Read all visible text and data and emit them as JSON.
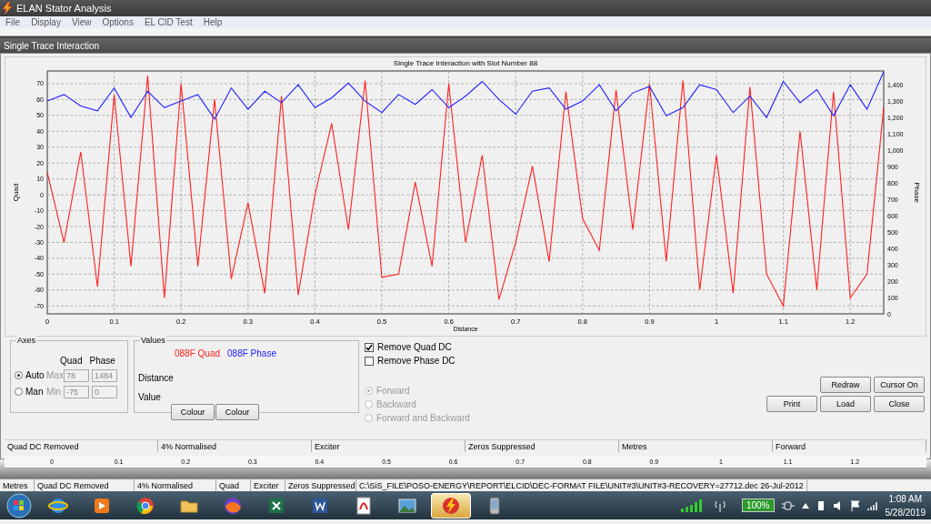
{
  "window": {
    "title": "ELAN Stator Analysis"
  },
  "menu": [
    "File",
    "Display",
    "View",
    "Options",
    "EL CID Test",
    "Help"
  ],
  "child_window": {
    "title": "Single Trace Interaction"
  },
  "chart": {
    "chart_data": {
      "type": "line",
      "grid": true,
      "title": "Single Trace Interaction with Slot Number 88",
      "xlabel": "Distance",
      "ylabel": "Quad",
      "y2label": "Phase",
      "xlim": [
        0,
        1.25
      ],
      "ylim": [
        -75,
        78
      ],
      "y2lim": [
        0,
        1484
      ],
      "xticks": [
        0,
        0.1,
        0.2,
        0.3,
        0.4,
        0.5,
        0.6,
        0.7,
        0.8,
        0.9,
        1,
        1.1,
        1.2
      ],
      "yticks": [
        -70,
        -60,
        -50,
        -40,
        -30,
        -20,
        -10,
        0,
        10,
        20,
        30,
        40,
        50,
        60,
        70
      ],
      "y2ticks": [
        {
          "value": 0,
          "label": "0"
        },
        {
          "value": 100,
          "label": "100"
        },
        {
          "value": 200,
          "label": "200"
        },
        {
          "value": 300,
          "label": "300"
        },
        {
          "value": 400,
          "label": "400"
        },
        {
          "value": 500,
          "label": "500"
        },
        {
          "value": 600,
          "label": "600"
        },
        {
          "value": 700,
          "label": "700"
        },
        {
          "value": 800,
          "label": "800"
        },
        {
          "value": 900,
          "label": "900"
        },
        {
          "value": 1000,
          "label": "1,000"
        },
        {
          "value": 1100,
          "label": "1,100"
        },
        {
          "value": 1200,
          "label": "1,200"
        },
        {
          "value": 1300,
          "label": "1,300"
        },
        {
          "value": 1400,
          "label": "1,400"
        }
      ],
      "x": [
        0,
        0.025,
        0.05,
        0.075,
        0.1,
        0.125,
        0.15,
        0.175,
        0.2,
        0.225,
        0.25,
        0.275,
        0.3,
        0.325,
        0.35,
        0.375,
        0.4,
        0.425,
        0.45,
        0.475,
        0.5,
        0.525,
        0.55,
        0.575,
        0.6,
        0.625,
        0.65,
        0.675,
        0.7,
        0.725,
        0.75,
        0.775,
        0.8,
        0.825,
        0.85,
        0.875,
        0.9,
        0.925,
        0.95,
        0.975,
        1,
        1.025,
        1.05,
        1.075,
        1.1,
        1.125,
        1.15,
        1.175,
        1.2,
        1.225,
        1.25
      ],
      "series": [
        {
          "name": "088F Quad",
          "color": "#ff2020",
          "values": [
            14,
            -30,
            27,
            -58,
            63,
            -45,
            75,
            -65,
            70,
            -45,
            60,
            -53,
            -5,
            -62,
            62,
            -63,
            0,
            45,
            -22,
            72,
            -52,
            -50,
            8,
            -45,
            70,
            -30,
            25,
            -66,
            -30,
            18,
            -42,
            65,
            -15,
            -35,
            66,
            -22,
            70,
            -42,
            72,
            -60,
            25,
            -62,
            68,
            -50,
            -70,
            40,
            -60,
            65,
            -65,
            -50,
            55
          ]
        },
        {
          "name": "088F Phase",
          "color": "#2020ff",
          "axis": "y2",
          "values": [
            1300,
            1340,
            1270,
            1240,
            1380,
            1200,
            1360,
            1260,
            1300,
            1340,
            1190,
            1380,
            1250,
            1360,
            1290,
            1400,
            1260,
            1320,
            1410,
            1300,
            1230,
            1340,
            1280,
            1370,
            1260,
            1330,
            1420,
            1310,
            1220,
            1360,
            1380,
            1250,
            1300,
            1400,
            1240,
            1350,
            1390,
            1210,
            1260,
            1400,
            1370,
            1230,
            1330,
            1200,
            1420,
            1290,
            1370,
            1210,
            1400,
            1250,
            1480
          ]
        }
      ]
    }
  },
  "axes": {
    "title": "Axes",
    "col_quad": "Quad",
    "col_phase": "Phase",
    "modes": [
      {
        "label": "Auto",
        "selected": true,
        "limit_label": "Max",
        "quad": "78",
        "phase": "1484"
      },
      {
        "label": "Man",
        "selected": false,
        "limit_label": "Min",
        "quad": "-75",
        "phase": "0"
      }
    ],
    "disabled": true
  },
  "values": {
    "title": "Values",
    "rows": [
      "Distance",
      "Value"
    ],
    "buttons": [
      "Colour",
      "Colour"
    ]
  },
  "options": [
    {
      "label": "Remove Quad DC",
      "checked": true
    },
    {
      "label": "Remove Phase DC",
      "checked": false
    }
  ],
  "direction": {
    "disabled": true,
    "items": [
      {
        "label": "Forward",
        "selected": true
      },
      {
        "label": "Backward",
        "selected": false
      },
      {
        "label": "Forward and Backward",
        "selected": false
      }
    ]
  },
  "buttons_row1": [
    "Redraw",
    "Cursor On"
  ],
  "buttons_row2": [
    "Print",
    "Load",
    "Close"
  ],
  "inner_status": [
    "Quad DC Removed",
    "4% Normalised",
    "Exciter",
    "Zeros Suppressed",
    "Metres",
    "Forward"
  ],
  "ruler": [
    "0",
    "0.1",
    "0.2",
    "0.3",
    "0.4",
    "0.5",
    "0.6",
    "0.7",
    "0.8",
    "0.9",
    "1",
    "1.1",
    "1.2"
  ],
  "status_bar": [
    "Metres",
    "Quad DC Removed",
    "4% Normalised",
    "Quad",
    "Exciter",
    "Zeros Suppressed",
    "C:\\SiS_FILE\\POSO-ENERGY\\REPORT\\ELCID\\DEC-FORMAT FILE\\UNIT#3\\UNIT#3-RECOVERY=27712.dec 26-Jul-2012"
  ],
  "taskbar": {
    "apps": [
      {
        "kind": "globe",
        "selected": false
      },
      {
        "kind": "play",
        "selected": false
      },
      {
        "kind": "wheel",
        "selected": false
      },
      {
        "kind": "folder",
        "selected": false
      },
      {
        "kind": "fox",
        "selected": false
      },
      {
        "kind": "sheet",
        "selected": false
      },
      {
        "kind": "doc",
        "selected": false
      },
      {
        "kind": "pdf",
        "selected": false
      },
      {
        "kind": "photo",
        "selected": false
      },
      {
        "kind": "bolt",
        "selected": true
      },
      {
        "kind": "phone",
        "selected": false
      }
    ],
    "battery": "100%",
    "time": "1:08 AM",
    "date": "5/28/2019"
  }
}
